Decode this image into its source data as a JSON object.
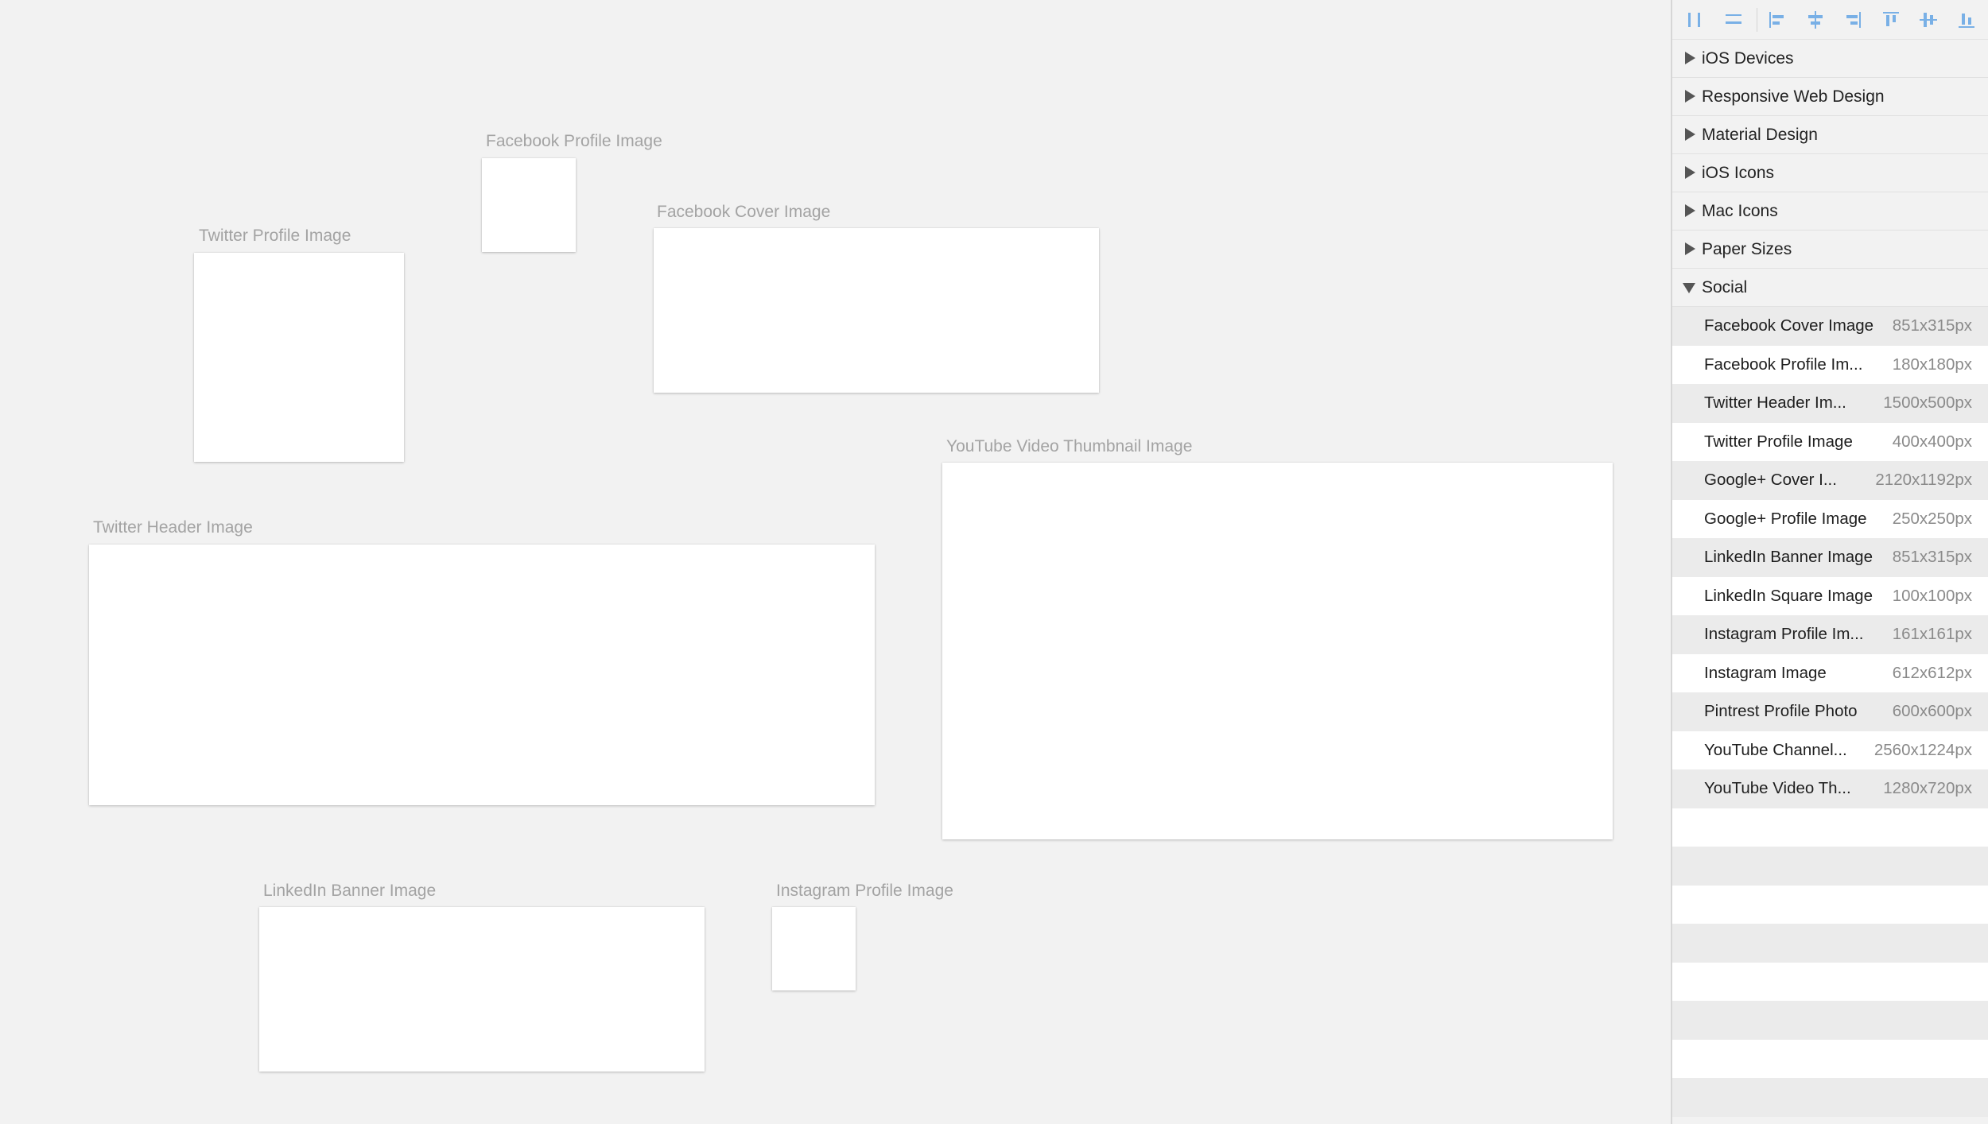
{
  "canvas": {
    "artboards": [
      {
        "id": "facebook-profile",
        "label": "Facebook Profile Image"
      },
      {
        "id": "twitter-profile",
        "label": "Twitter Profile Image"
      },
      {
        "id": "facebook-cover",
        "label": "Facebook Cover Image"
      },
      {
        "id": "youtube-thumb",
        "label": "YouTube Video Thumbnail Image"
      },
      {
        "id": "twitter-header",
        "label": "Twitter Header Image"
      },
      {
        "id": "linkedin-banner",
        "label": "LinkedIn Banner Image"
      },
      {
        "id": "instagram-profile",
        "label": "Instagram Profile Image"
      }
    ]
  },
  "toolbar": {
    "tools": [
      "distribute-horizontal-icon",
      "distribute-vertical-icon",
      "align-left-icon",
      "align-center-horizontal-icon",
      "align-right-icon",
      "align-top-icon",
      "align-middle-vertical-icon",
      "align-bottom-icon"
    ],
    "accent_color": "#79b0e6"
  },
  "panel": {
    "groups": [
      {
        "label": "iOS Devices",
        "expanded": false
      },
      {
        "label": "Responsive Web Design",
        "expanded": false
      },
      {
        "label": "Material Design",
        "expanded": false
      },
      {
        "label": "iOS Icons",
        "expanded": false
      },
      {
        "label": "Mac Icons",
        "expanded": false
      },
      {
        "label": "Paper Sizes",
        "expanded": false
      },
      {
        "label": "Social",
        "expanded": true
      }
    ],
    "social_presets": [
      {
        "name": "Facebook Cover Image",
        "size": "851x315px"
      },
      {
        "name": "Facebook Profile Im...",
        "size": "180x180px"
      },
      {
        "name": "Twitter Header Im...",
        "size": "1500x500px"
      },
      {
        "name": "Twitter Profile Image",
        "size": "400x400px"
      },
      {
        "name": "Google+ Cover I...",
        "size": "2120x1192px"
      },
      {
        "name": "Google+ Profile Image",
        "size": "250x250px"
      },
      {
        "name": "LinkedIn Banner Image",
        "size": "851x315px"
      },
      {
        "name": "LinkedIn Square Image",
        "size": "100x100px"
      },
      {
        "name": "Instagram Profile Im...",
        "size": "161x161px"
      },
      {
        "name": "Instagram Image",
        "size": "612x612px"
      },
      {
        "name": "Pintrest Profile Photo",
        "size": "600x600px"
      },
      {
        "name": "YouTube Channel...",
        "size": "2560x1224px"
      },
      {
        "name": "YouTube Video Th...",
        "size": "1280x720px"
      }
    ]
  }
}
